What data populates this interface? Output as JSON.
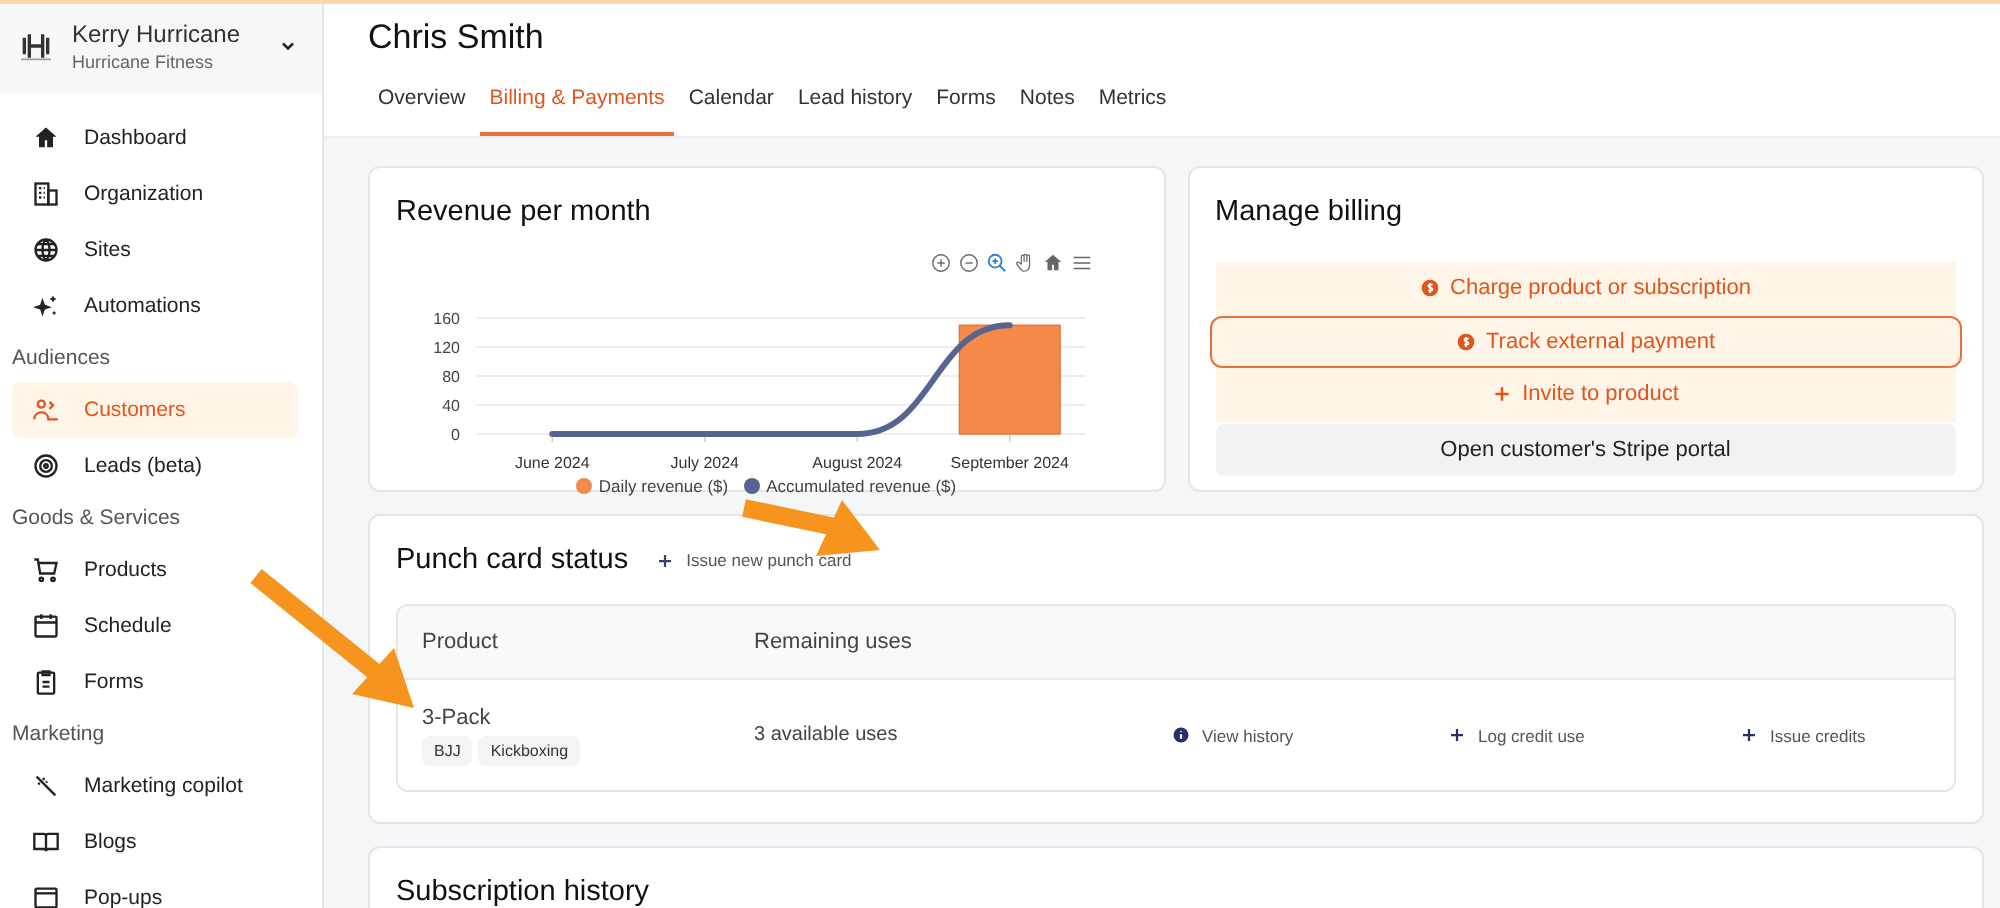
{
  "account": {
    "name": "Kerry Hurricane",
    "organization": "Hurricane Fitness"
  },
  "sidebar": {
    "sections": [
      {
        "items": [
          {
            "label": "Dashboard",
            "selected": false
          },
          {
            "label": "Organization",
            "selected": false
          },
          {
            "label": "Sites",
            "selected": false
          },
          {
            "label": "Automations",
            "selected": false
          }
        ]
      },
      {
        "heading": "Audiences",
        "items": [
          {
            "label": "Customers",
            "selected": true
          },
          {
            "label": "Leads (beta)",
            "selected": false
          }
        ]
      },
      {
        "heading": "Goods & Services",
        "items": [
          {
            "label": "Products",
            "selected": false
          },
          {
            "label": "Schedule",
            "selected": false
          },
          {
            "label": "Forms",
            "selected": false
          }
        ]
      },
      {
        "heading": "Marketing",
        "items": [
          {
            "label": "Marketing copilot",
            "selected": false
          },
          {
            "label": "Blogs",
            "selected": false
          },
          {
            "label": "Pop-ups",
            "selected": false
          }
        ]
      }
    ]
  },
  "page": {
    "title": "Chris Smith"
  },
  "tabs": [
    {
      "label": "Overview",
      "selected": false
    },
    {
      "label": "Billing & Payments",
      "selected": true
    },
    {
      "label": "Calendar",
      "selected": false
    },
    {
      "label": "Lead history",
      "selected": false
    },
    {
      "label": "Forms",
      "selected": false
    },
    {
      "label": "Notes",
      "selected": false
    },
    {
      "label": "Metrics",
      "selected": false
    }
  ],
  "revenue": {
    "title": "Revenue per month",
    "chart_data": {
      "type": "bar",
      "categories": [
        "June 2024",
        "July 2024",
        "August 2024",
        "September 2024"
      ],
      "ylim": [
        0,
        160
      ],
      "grid": true,
      "yticks": [
        0,
        40,
        80,
        120,
        160
      ],
      "series": [
        {
          "name": "Daily revenue ($)",
          "color": "#f5894a",
          "type": "bar",
          "values": [
            0,
            0,
            0,
            150
          ]
        },
        {
          "name": "Accumulated revenue ($)",
          "color": "#56648f",
          "type": "line",
          "values": [
            0,
            0,
            0,
            150
          ]
        }
      ]
    }
  },
  "billing": {
    "title": "Manage billing",
    "actions": [
      {
        "label": "Charge product or subscription",
        "kind": "coin"
      },
      {
        "label": "Track external payment",
        "kind": "highlight"
      },
      {
        "label": "Invite to product",
        "kind": "plus"
      },
      {
        "label": "Open customer's Stripe portal",
        "kind": "plain"
      }
    ]
  },
  "punch_cards": {
    "title": "Punch card status",
    "issue_link": "Issue new punch card",
    "columns": [
      "Product",
      "Remaining uses"
    ],
    "rows": [
      {
        "product": "3-Pack",
        "tags": [
          "BJJ",
          "Kickboxing"
        ],
        "remaining": "3 available uses",
        "actions": [
          {
            "label": "View history",
            "kind": "info"
          },
          {
            "label": "Log credit use",
            "kind": "plus"
          },
          {
            "label": "Issue credits",
            "kind": "plus"
          }
        ]
      }
    ]
  },
  "subscriptions": {
    "title": "Subscription history"
  }
}
